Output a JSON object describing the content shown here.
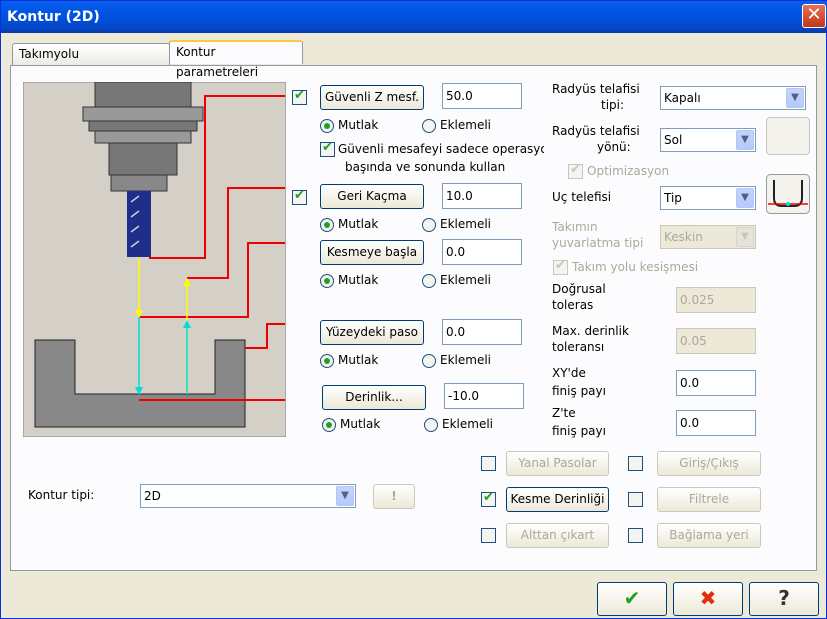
{
  "window": {
    "title": "Kontur (2D)",
    "close": "✕"
  },
  "tabs": [
    {
      "label": "Takımyolu parametreleri"
    },
    {
      "label": "Kontur parametreleri"
    }
  ],
  "left": {
    "guvenli": {
      "label": "Güvenli Z mesf.",
      "value": "50.0",
      "mutlak": "Mutlak",
      "eklemeli": "Eklemeli",
      "only_ops": "Güvenli mesafeyi sadece operasyon",
      "only_ops2": "başında ve sonunda kullan"
    },
    "geri": {
      "label": "Geri Kaçma",
      "value": "10.0",
      "mutlak": "Mutlak",
      "eklemeli": "Eklemeli"
    },
    "kesmeye": {
      "label": "Kesmeye başla",
      "value": "0.0",
      "mutlak": "Mutlak",
      "eklemeli": "Eklemeli"
    },
    "yuzey": {
      "label": "Yüzeydeki paso",
      "value": "0.0",
      "mutlak": "Mutlak",
      "eklemeli": "Eklemeli"
    },
    "derinlik": {
      "label": "Derinlik...",
      "value": "-10.0",
      "mutlak": "Mutlak",
      "eklemeli": "Eklemeli"
    },
    "kontur_tipi": {
      "label": "Kontur tipi:",
      "value": "2D",
      "warn": "!"
    }
  },
  "right": {
    "radyus_tipi": {
      "label1": "Radyüs telafisi",
      "label2": "tipi:",
      "value": "Kapalı"
    },
    "radyus_yonu": {
      "label1": "Radyüs telafisi",
      "label2": "yönü:",
      "value": "Sol"
    },
    "optimizasyon": "Optimizasyon",
    "uc": {
      "label": "Uç telefisi",
      "value": "Tip"
    },
    "takim_yuv": {
      "label1": "Takımın",
      "label2": "yuvarlatma tipi",
      "value": "Keskin"
    },
    "kesisme": "Takım yolu kesişmesi",
    "dogrusal": {
      "label1": "Doğrusal",
      "label2": "toleras",
      "value": "0.025"
    },
    "max_der": {
      "label1": "Max. derinlik",
      "label2": "toleransı",
      "value": "0.05"
    },
    "xy": {
      "label1": "XY'de",
      "label2": "finiş payı",
      "value": "0.0"
    },
    "z": {
      "label1": "Z'te",
      "label2": "finiş payı",
      "value": "0.0"
    }
  },
  "bottom_buttons": {
    "yanal": "Yanal Pasolar",
    "giris": "Giriş/Çıkış",
    "kesme_der": "Kesme Derinliği",
    "filtre": "Filtrele",
    "alttan": "Alttan çıkart",
    "baglama": "Bağlama yeri"
  },
  "footer": {
    "ok": "✔",
    "cancel": "✖",
    "help": "?"
  },
  "colors": {
    "ok": "#21a121",
    "cancel": "#e03010",
    "accent": "#0054e3"
  }
}
